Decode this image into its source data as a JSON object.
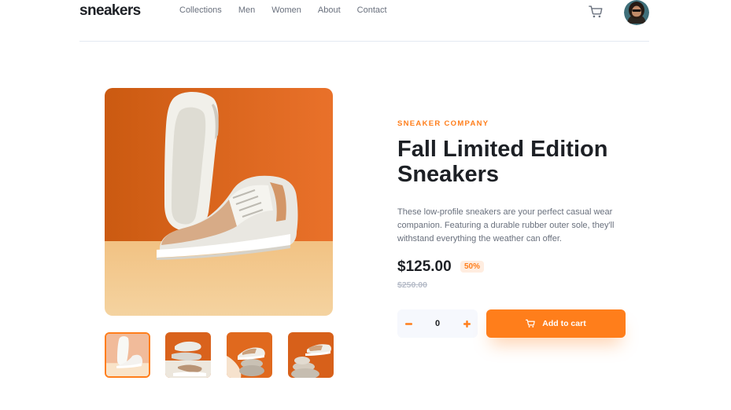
{
  "header": {
    "logo": "sneakers",
    "nav": [
      "Collections",
      "Men",
      "Women",
      "About",
      "Contact"
    ],
    "cart_icon": "cart-icon",
    "avatar_icon": "avatar"
  },
  "product": {
    "company": "SNEAKER COMPANY",
    "title": "Fall Limited Edition Sneakers",
    "description": "These low-profile sneakers are your perfect casual wear companion. Featuring a durable rubber outer sole, they'll withstand everything the weather can offer.",
    "price": "$125.00",
    "discount": "50%",
    "original_price": "$250.00",
    "quantity": "0",
    "add_to_cart_label": "Add to cart"
  },
  "gallery": {
    "active_thumbnail": 1,
    "thumbnail_count": 4
  },
  "colors": {
    "accent": "#ff7e1b",
    "accent_light": "#ffede0",
    "text_dark": "#1d2025",
    "text_grey": "#69707d",
    "text_light": "#b6bcc8",
    "stepper_bg": "#f6f8fd"
  }
}
